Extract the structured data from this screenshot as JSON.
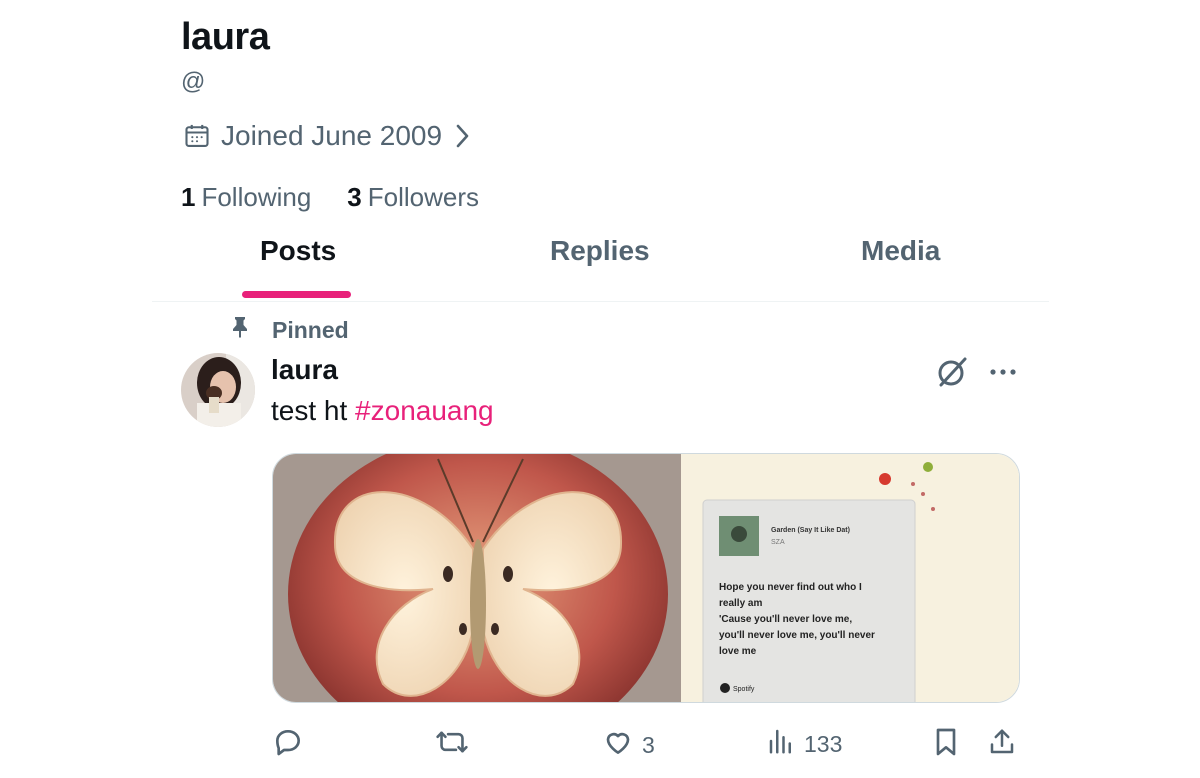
{
  "profile": {
    "name": "laura",
    "handle": "@",
    "joined": "Joined June 2009",
    "following_count": "1",
    "following_label": "Following",
    "followers_count": "3",
    "followers_label": "Followers"
  },
  "tabs": [
    {
      "label": "Posts",
      "active": true
    },
    {
      "label": "Replies",
      "active": false
    },
    {
      "label": "Media",
      "active": false
    }
  ],
  "post": {
    "pinned_label": "Pinned",
    "author": "laura",
    "text": "test ht ",
    "hashtag": "#zonauang",
    "card": {
      "song_title": "Garden (Say It Like Dat)",
      "artist": "SZA",
      "lyrics": "Hope you never find out who I really am 'Cause you'll never love me, you'll never love me, you'll never love me",
      "brand": "Spotify"
    },
    "actions": {
      "reply_count": "",
      "repost_count": "",
      "like_count": "3",
      "views_count": "133"
    }
  },
  "colors": {
    "accent": "#e8217a",
    "text_primary": "#0f1419",
    "text_secondary": "#536471"
  },
  "icons": [
    "calendar-icon",
    "chevron-right-icon",
    "pin-icon",
    "grok-icon",
    "more-icon",
    "reply-icon",
    "repost-icon",
    "like-icon",
    "views-icon",
    "bookmark-icon",
    "share-icon"
  ]
}
